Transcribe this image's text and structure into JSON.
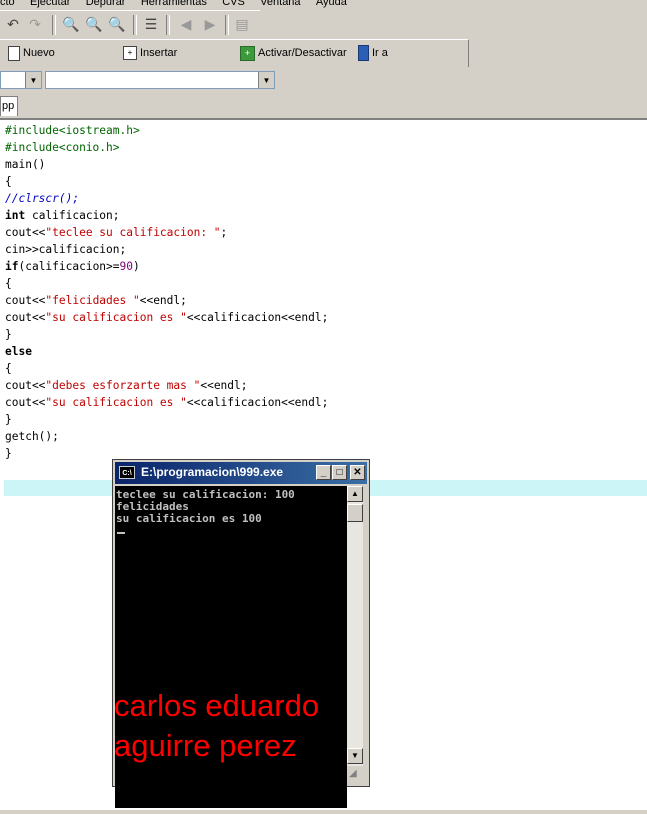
{
  "menubar": {
    "items": [
      "cto",
      "Ejecutar",
      "Depurar",
      "Herramientas",
      "CVS",
      "Ventana",
      "Ayuda"
    ]
  },
  "toolbar2": {
    "nuevo": "Nuevo",
    "insertar": "Insertar",
    "activar": "Activar/Desactivar",
    "ira": "Ir a"
  },
  "tab": {
    "label": "pp"
  },
  "code": {
    "lines": [
      "#include<iostream.h>",
      "#include<conio.h>",
      "main()",
      "{",
      "//clrscr();",
      "int calificacion;",
      "cout<<\"teclee su calificacion: \";",
      "cin>>calificacion;",
      "if(calificacion>=90)",
      "{",
      "cout<<\"felicidades \"<<endl;",
      "cout<<\"su calificacion es \"<<calificacion<<endl;",
      "}",
      "else",
      "{",
      "cout<<\"debes esforzarte mas \"<<endl;",
      "cout<<\"su calificacion es \"<<calificacion<<endl;",
      "}",
      "getch();",
      "}"
    ]
  },
  "console": {
    "title": "E:\\programacion\\999.exe",
    "output": [
      "teclee su calificacion: 100",
      "felicidades",
      "su calificacion es 100"
    ]
  },
  "overlay": {
    "text": "carlos eduardo\naguirre perez"
  },
  "colors": {
    "string": "#c00000",
    "preprocessor": "#006400",
    "number": "#800080",
    "comment": "#0000c0",
    "overlay": "#ff0000",
    "highlight": "#ccf5f8"
  }
}
